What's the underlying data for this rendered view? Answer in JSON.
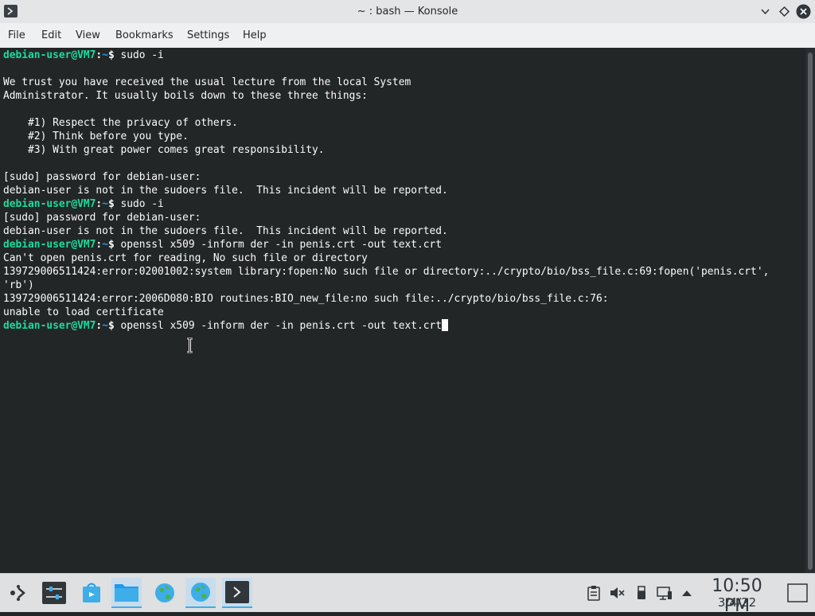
{
  "window": {
    "title": "~ : bash — Konsole"
  },
  "menu": [
    "File",
    "Edit",
    "View",
    "Bookmarks",
    "Settings",
    "Help"
  ],
  "prompt": {
    "user_host": "debian-user@VM7",
    "path": "~"
  },
  "terminal": {
    "lines": [
      {
        "type": "cmd",
        "cmd": "sudo -i"
      },
      {
        "type": "out",
        "text": ""
      },
      {
        "type": "out",
        "text": "We trust you have received the usual lecture from the local System"
      },
      {
        "type": "out",
        "text": "Administrator. It usually boils down to these three things:"
      },
      {
        "type": "out",
        "text": ""
      },
      {
        "type": "out",
        "text": "    #1) Respect the privacy of others."
      },
      {
        "type": "out",
        "text": "    #2) Think before you type."
      },
      {
        "type": "out",
        "text": "    #3) With great power comes great responsibility."
      },
      {
        "type": "out",
        "text": ""
      },
      {
        "type": "out",
        "text": "[sudo] password for debian-user:"
      },
      {
        "type": "out",
        "text": "debian-user is not in the sudoers file.  This incident will be reported."
      },
      {
        "type": "cmd",
        "cmd": "sudo -i"
      },
      {
        "type": "out",
        "text": "[sudo] password for debian-user:"
      },
      {
        "type": "out",
        "text": "debian-user is not in the sudoers file.  This incident will be reported."
      },
      {
        "type": "cmd",
        "cmd": "openssl x509 -inform der -in penis.crt -out text.crt"
      },
      {
        "type": "out",
        "text": "Can't open penis.crt for reading, No such file or directory"
      },
      {
        "type": "out",
        "text": "139729006511424:error:02001002:system library:fopen:No such file or directory:../crypto/bio/bss_file.c:69:fopen('penis.crt',"
      },
      {
        "type": "out",
        "text": "'rb')"
      },
      {
        "type": "out",
        "text": "139729006511424:error:2006D080:BIO routines:BIO_new_file:no such file:../crypto/bio/bss_file.c:76:"
      },
      {
        "type": "out",
        "text": "unable to load certificate"
      },
      {
        "type": "cmd",
        "cmd": "openssl x509 -inform der -in penis.crt -out text.crt",
        "cursor": true
      }
    ]
  },
  "taskbar": {
    "launchers": [
      {
        "name": "application-launcher",
        "active": false
      },
      {
        "name": "system-settings",
        "active": false
      },
      {
        "name": "discover",
        "active": false
      },
      {
        "name": "dolphin",
        "active": true
      },
      {
        "name": "web-browser",
        "active": false
      },
      {
        "name": "web-browser-2",
        "active": true
      },
      {
        "name": "konsole",
        "active": true
      }
    ],
    "tray": [
      "clipboard-icon",
      "volume-muted-icon",
      "usb-icon",
      "network-icon",
      "expand-tray-icon"
    ],
    "clock_time": "10:50 PM",
    "clock_date": "3/4/22"
  },
  "colors": {
    "terminal_bg": "#232627",
    "prompt_user": "#1cdc9a",
    "prompt_path": "#1d99f3",
    "text": "#fcfcfc"
  }
}
